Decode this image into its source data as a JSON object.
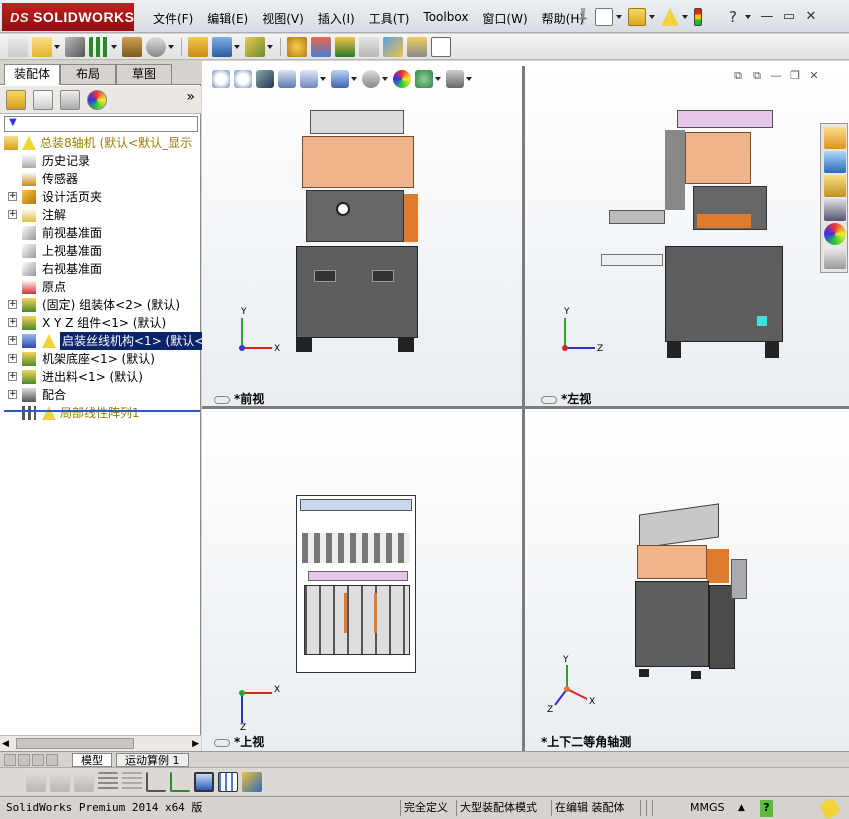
{
  "app": {
    "logo_text": "SOLIDWORKS",
    "logo_prefix": "DS",
    "menu": [
      "文件(F)",
      "编辑(E)",
      "视图(V)",
      "插入(I)",
      "工具(T)",
      "Toolbox",
      "窗口(W)",
      "帮助(H)"
    ],
    "help_symbol": "?"
  },
  "panel": {
    "tabs": [
      "装配体",
      "布局",
      "草图"
    ],
    "active_tab": "装配体",
    "expand_symbol": "»",
    "tree": [
      {
        "label": "总装8轴机 (默认<默认_显示",
        "icon": "assembly-warning-icon",
        "indent": 0,
        "expander": false,
        "warn": true,
        "root": true
      },
      {
        "label": "历史记录",
        "icon": "history-icon",
        "indent": 1,
        "expander": false
      },
      {
        "label": "传感器",
        "icon": "sensor-icon",
        "indent": 1,
        "expander": false
      },
      {
        "label": "设计活页夹",
        "icon": "design-binder-icon",
        "indent": 1,
        "expander": true
      },
      {
        "label": "注解",
        "icon": "annotation-icon",
        "indent": 1,
        "expander": true
      },
      {
        "label": "前视基准面",
        "icon": "plane-icon",
        "indent": 1,
        "expander": false
      },
      {
        "label": "上视基准面",
        "icon": "plane-icon",
        "indent": 1,
        "expander": false
      },
      {
        "label": "右视基准面",
        "icon": "plane-icon",
        "indent": 1,
        "expander": false
      },
      {
        "label": "原点",
        "icon": "origin-icon",
        "indent": 1,
        "expander": false
      },
      {
        "label": "(固定) 组装体<2> (默认)",
        "icon": "subassembly-icon",
        "indent": 1,
        "expander": true
      },
      {
        "label": "X Y Z 组件<1> (默认)",
        "icon": "subassembly-icon",
        "indent": 1,
        "expander": true
      },
      {
        "label": "启装丝线机构<1> (默认<默",
        "icon": "subassembly-warning-icon",
        "indent": 1,
        "expander": true,
        "selected": true,
        "warn": true
      },
      {
        "label": "机架底座<1> (默认)",
        "icon": "subassembly-icon",
        "indent": 1,
        "expander": true
      },
      {
        "label": "进出料<1> (默认)",
        "icon": "subassembly-icon",
        "indent": 1,
        "expander": true
      },
      {
        "label": "配合",
        "icon": "mates-icon",
        "indent": 1,
        "expander": true
      },
      {
        "label": "局部线性阵列1",
        "icon": "linear-pattern-warning-icon",
        "indent": 1,
        "expander": false,
        "warn": true,
        "warn_text": true
      }
    ]
  },
  "viewports": {
    "front_label": "*前视",
    "left_label": "*左视",
    "top_label": "*上视",
    "iso_label": "*上下二等角轴测"
  },
  "axes": {
    "x": "X",
    "y": "Y",
    "z": "Z"
  },
  "bottom_tabs": {
    "model": "模型",
    "motion": "运动算例 1"
  },
  "status": {
    "product": "SolidWorks Premium 2014 x64 版",
    "defined": "完全定义",
    "large_mode": "大型装配体模式",
    "editing": "在编辑 装配体",
    "units": "MMGS",
    "help": "?"
  },
  "colors": {
    "accent_orange": "#e07b2e",
    "machine_gray": "#5e5e5e",
    "peach": "#f0b48a",
    "selection": "#0a246a",
    "logo_red": "#b01818"
  }
}
